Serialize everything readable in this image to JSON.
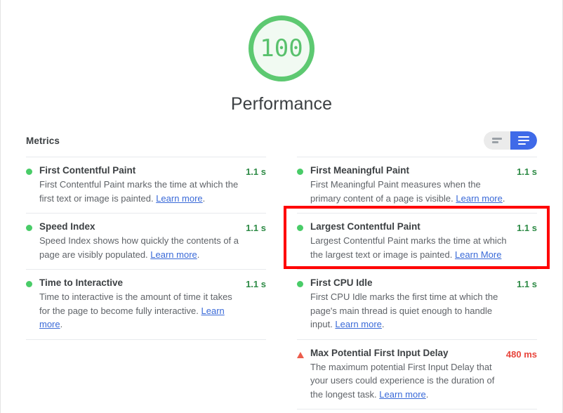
{
  "score": {
    "value": "100",
    "label": "Performance",
    "ring_color": "#5dc971",
    "fill_color": "#f1faf2",
    "text_color": "#59c16d"
  },
  "metrics_section": {
    "title": "Metrics",
    "view_toggle": {
      "collapsed_label": "collapsed-view",
      "expanded_label": "expanded-view",
      "active": "expanded",
      "active_color": "#3f6ae8",
      "inactive_color": "#ebebeb"
    }
  },
  "metrics": {
    "left_column": [
      {
        "icon": "status-dot-pass",
        "status": "pass",
        "name": "First Contentful Paint",
        "description": "First Contentful Paint marks the time at which the first text or image is painted. ",
        "link_text": "Learn more",
        "description_tail": ".",
        "value": "1.1 s",
        "value_color": "#2e8b46"
      },
      {
        "icon": "status-dot-pass",
        "status": "pass",
        "name": "Speed Index",
        "description": "Speed Index shows how quickly the contents of a page are visibly populated. ",
        "link_text": "Learn more",
        "description_tail": ".",
        "value": "1.1 s",
        "value_color": "#2e8b46"
      },
      {
        "icon": "status-dot-pass",
        "status": "pass",
        "name": "Time to Interactive",
        "description": "Time to interactive is the amount of time it takes for the page to become fully interactive. ",
        "link_text": "Learn more",
        "description_tail": ".",
        "value": "1.1 s",
        "value_color": "#2e8b46"
      }
    ],
    "right_column": [
      {
        "icon": "status-dot-pass",
        "status": "pass",
        "name": "First Meaningful Paint",
        "description": "First Meaningful Paint measures when the primary content of a page is visible. ",
        "link_text": "Learn more",
        "description_tail": ".",
        "value": "1.1 s",
        "value_color": "#2e8b46"
      },
      {
        "icon": "status-dot-pass",
        "status": "pass",
        "name": "Largest Contentful Paint",
        "description": "Largest Contentful Paint marks the time at which the largest text or image is painted. ",
        "link_text": "Learn More",
        "description_tail": "",
        "value": "1.1 s",
        "value_color": "#2e8b46",
        "highlighted": true
      },
      {
        "icon": "status-dot-pass",
        "status": "pass",
        "name": "First CPU Idle",
        "description": "First CPU Idle marks the first time at which the page's main thread is quiet enough to handle input. ",
        "link_text": "Learn more",
        "description_tail": ".",
        "value": "1.1 s",
        "value_color": "#2e8b46"
      },
      {
        "icon": "warning-triangle",
        "status": "warn",
        "name": "Max Potential First Input Delay",
        "description": "The maximum potential First Input Delay that your users could experience is the duration of the longest task. ",
        "link_text": "Learn more",
        "description_tail": ".",
        "value": "480 ms",
        "value_color": "#e8453c"
      }
    ]
  },
  "annotation": {
    "highlight_color": "#ff0000",
    "target": "Largest Contentful Paint"
  }
}
